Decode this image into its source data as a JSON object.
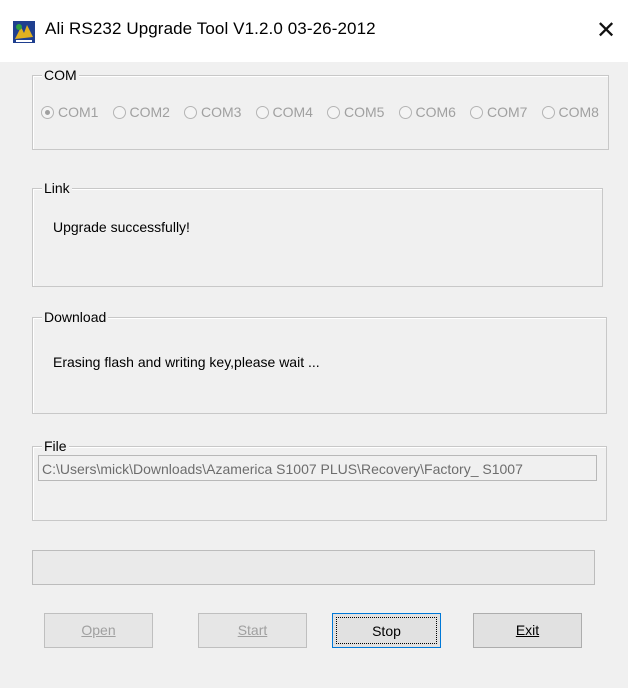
{
  "window": {
    "title": "Ali RS232 Upgrade Tool   V1.2.0  03-26-2012",
    "close_glyph": "✕"
  },
  "com_group": {
    "label": "COM",
    "options": [
      {
        "label": "COM1",
        "selected": true
      },
      {
        "label": "COM2",
        "selected": false
      },
      {
        "label": "COM3",
        "selected": false
      },
      {
        "label": "COM4",
        "selected": false
      },
      {
        "label": "COM5",
        "selected": false
      },
      {
        "label": "COM6",
        "selected": false
      },
      {
        "label": "COM7",
        "selected": false
      },
      {
        "label": "COM8",
        "selected": false
      }
    ]
  },
  "link_group": {
    "label": "Link",
    "message": "Upgrade successfully!"
  },
  "download_group": {
    "label": "Download",
    "message": "Erasing flash and writing key,please wait ..."
  },
  "file_group": {
    "label": "File",
    "path": "C:\\Users\\mick\\Downloads\\Azamerica S1007 PLUS\\Recovery\\Factory_ S1007"
  },
  "progress": {
    "value": 0
  },
  "buttons": {
    "open": {
      "label": "Open",
      "enabled": false
    },
    "start": {
      "label": "Start",
      "enabled": false
    },
    "stop": {
      "label": "Stop",
      "enabled": true
    },
    "exit": {
      "label": "Exit",
      "enabled": true
    }
  },
  "colors": {
    "background": "#f0f0f0",
    "disabled_text": "#a0a0a0",
    "focus_border": "#0078d7"
  }
}
